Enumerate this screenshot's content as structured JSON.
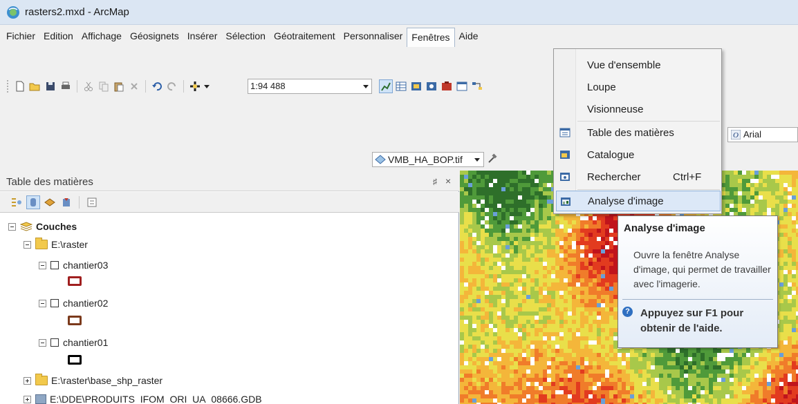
{
  "window": {
    "title": "rasters2.mxd - ArcMap"
  },
  "menu": [
    "Fichier",
    "Edition",
    "Affichage",
    "Géosignets",
    "Insérer",
    "Sélection",
    "Géotraitement",
    "Personnaliser",
    "Fenêtres",
    "Aide"
  ],
  "active_menu": "Fenêtres",
  "toolbar": {
    "scale_value": "1:94 488",
    "layer_value": "VMB_HA_BOP.tif",
    "font_value": "Arial",
    "d_label": "D"
  },
  "dropdown": {
    "items": [
      {
        "label": "Vue d'ensemble",
        "icon": "none"
      },
      {
        "label": "Loupe",
        "icon": "none"
      },
      {
        "label": "Visionneuse",
        "icon": "none"
      },
      {
        "label": "Table des matières",
        "icon": "toc-icon"
      },
      {
        "label": "Catalogue",
        "icon": "catalog-icon"
      },
      {
        "label": "Rechercher",
        "shortcut": "Ctrl+F",
        "icon": "search-window-icon"
      },
      {
        "label": "Analyse d'image",
        "icon": "image-analysis-icon",
        "highlighted": true
      }
    ]
  },
  "tooltip": {
    "title": "Analyse d'image",
    "body": "Ouvre la fenêtre Analyse d'image, qui permet de travailler avec l'imagerie.",
    "help": "Appuyez sur F1 pour obtenir de l'aide."
  },
  "toc": {
    "title": "Table des matières",
    "pin": "♯",
    "close": "×",
    "tree": {
      "root": "Couches",
      "folder1": "E:\\raster",
      "layers": [
        {
          "name": "chantier03",
          "color": "#a01f1f"
        },
        {
          "name": "chantier02",
          "color": "#7b3a1c"
        },
        {
          "name": "chantier01",
          "color": "#000000"
        }
      ],
      "folder2": "E:\\raster\\base_shp_raster",
      "gdb": "E:\\DDE\\PRODUITS_IFOM_ORI_UA_08666.GDB"
    }
  }
}
